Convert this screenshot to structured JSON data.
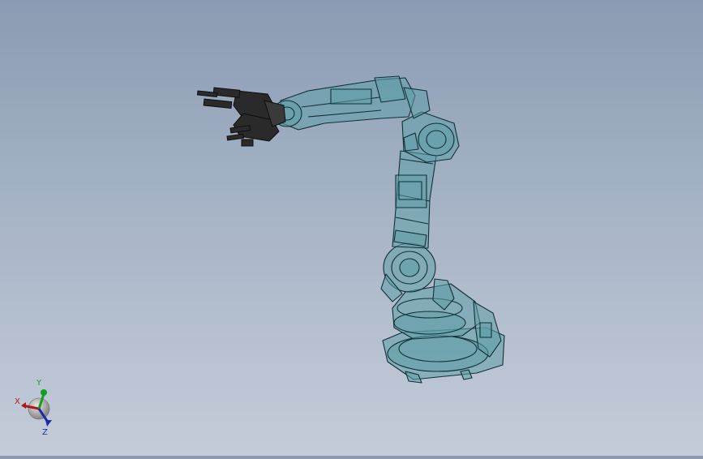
{
  "viewport": {
    "model": "robot-arm-assembly",
    "display_mode": "transparent-wireframe",
    "colors": {
      "background_top": "#8a9bb3",
      "background_bottom": "#c4ccd8",
      "body_fill": "#5f9ea8",
      "edge_line": "#0f3035",
      "gripper_fill": "#2a2a2a"
    }
  },
  "triad": {
    "x_label": "X",
    "y_label": "Y",
    "z_label": "Z",
    "colors": {
      "x": "#b01818",
      "y": "#12a020",
      "z": "#1a2aa8"
    }
  }
}
